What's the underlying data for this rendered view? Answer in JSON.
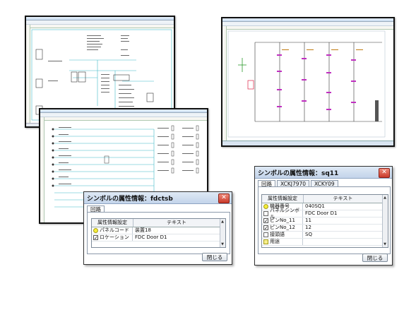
{
  "screens": {
    "top_left": {
      "title": "Screenshot of schematic editor (wiring list view)"
    },
    "top_right": {
      "title": "Screenshot of schematic editor (ladder view)"
    },
    "middle": {
      "title": "Screenshot of schematic editor (terminal list view)"
    }
  },
  "dialog_fdctsb": {
    "title": "シンボルの属性情報：fdctsb",
    "tabs": [
      "回路"
    ],
    "columns": [
      "属性情報設定",
      "テキスト"
    ],
    "rows": [
      {
        "icon": "yellow-circle",
        "name": "パネルコード",
        "value": "装置18"
      },
      {
        "icon": "checkbox",
        "name": "ロケーション",
        "value": "FDC Door D1"
      }
    ],
    "close_label": "閉じる"
  },
  "dialog_sq11": {
    "title": "シンボルの属性情報：sq11",
    "tabs": [
      "回路",
      "XCKJ7970",
      "XCKY09"
    ],
    "columns": [
      "属性情報設定",
      "テキスト"
    ],
    "rows": [
      {
        "icon": "yellow-circle",
        "name": "機器番号",
        "value": "040SQ1"
      },
      {
        "icon": "empty-box",
        "name": "パネルシンボル",
        "value": "FDC Door D1"
      },
      {
        "icon": "checkbox",
        "name": "ピンNo_11",
        "value": "11"
      },
      {
        "icon": "checkbox",
        "name": "ピンNo_12",
        "value": "12"
      },
      {
        "icon": "empty-box",
        "name": "接頭語",
        "value": "SQ"
      },
      {
        "icon": "yellow-box",
        "name": "用途",
        "value": ""
      }
    ],
    "close_label": "閉じる"
  }
}
